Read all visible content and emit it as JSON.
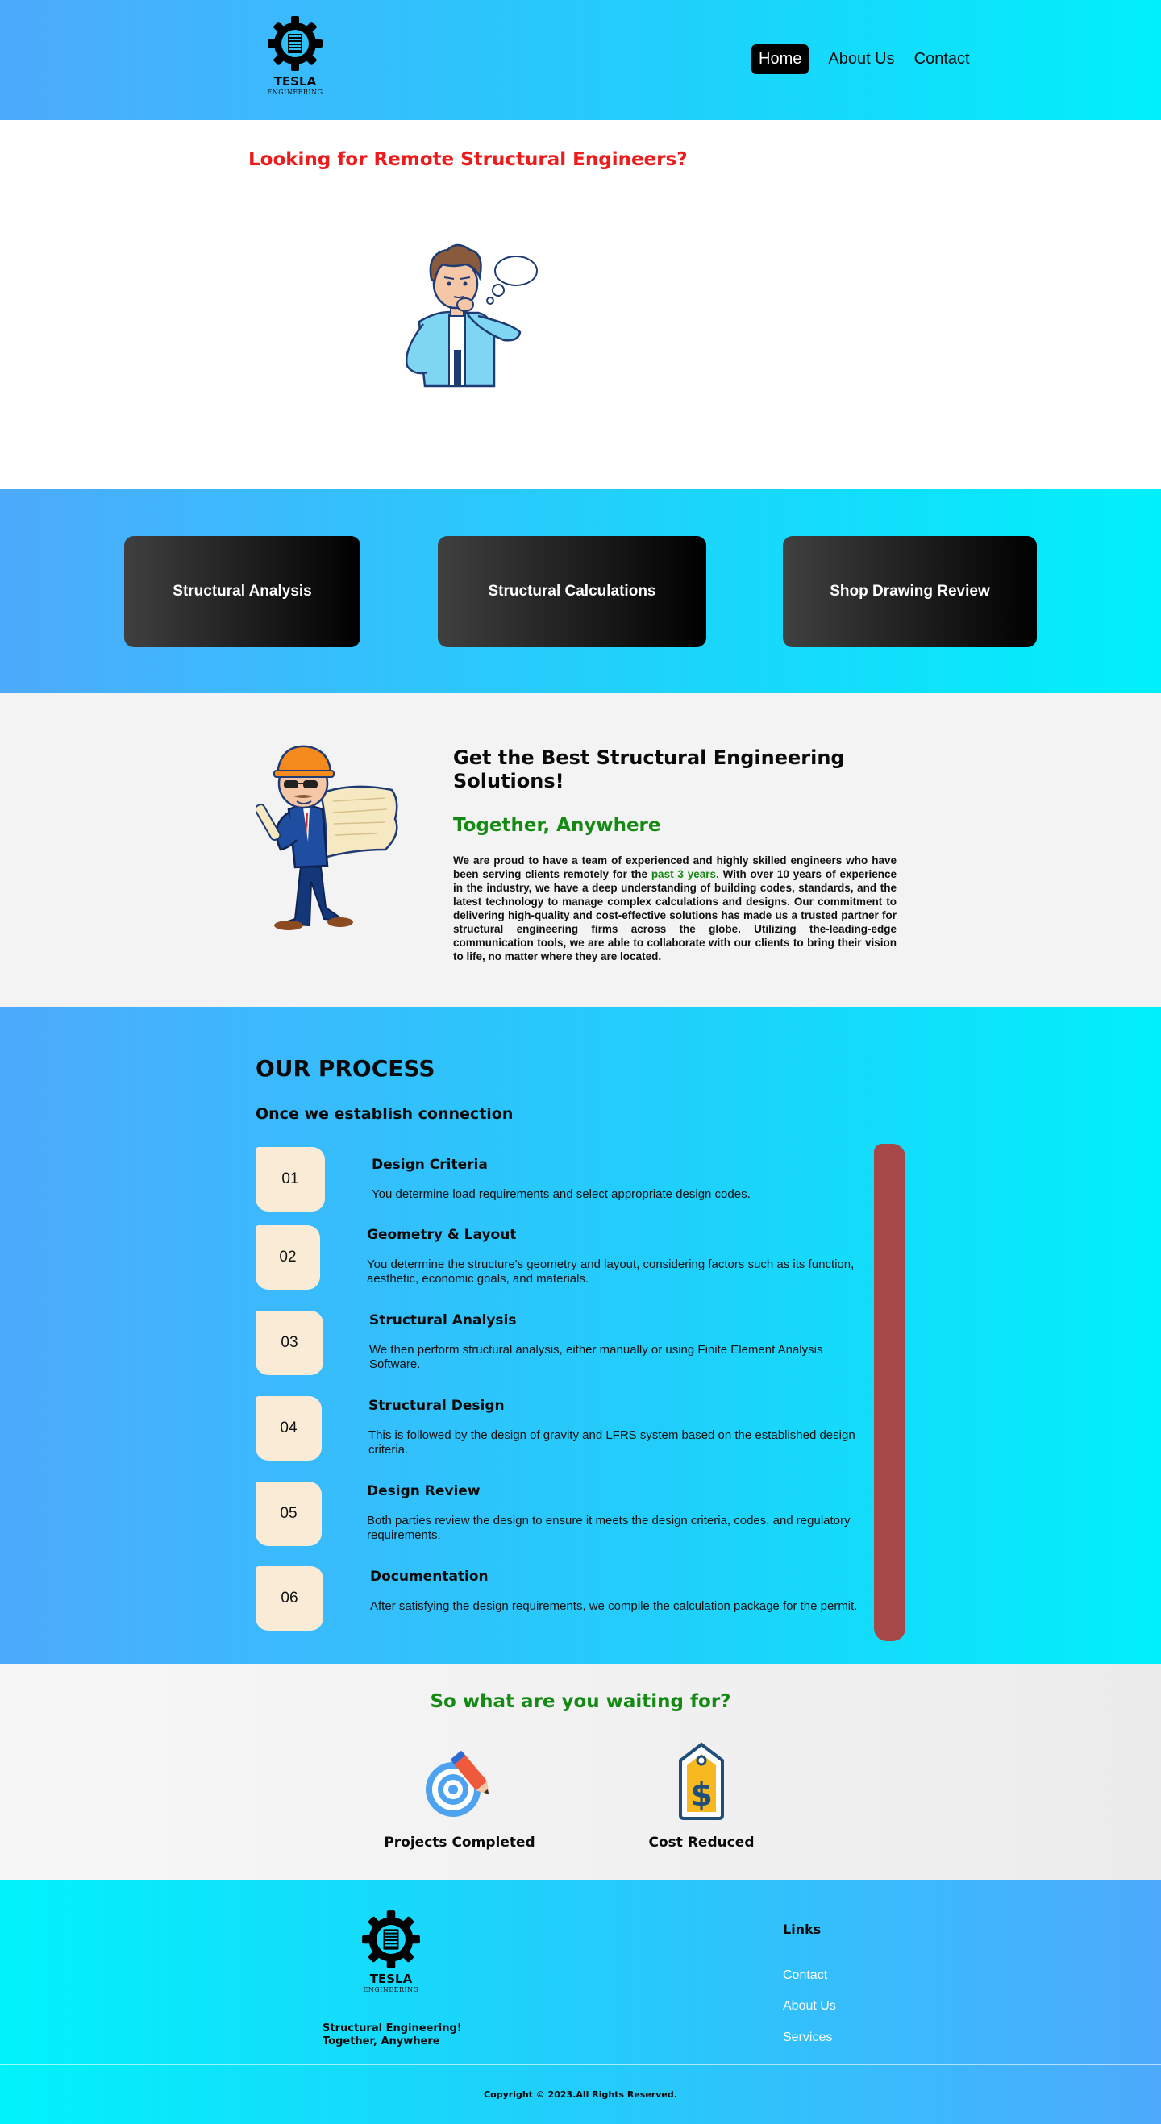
{
  "header": {
    "logo": {
      "brand": "TESLA",
      "sub": "ENGINEERING"
    },
    "nav": [
      {
        "label": "Home",
        "active": true
      },
      {
        "label": "About Us",
        "active": false
      },
      {
        "label": "Contact",
        "active": false
      }
    ]
  },
  "hero": {
    "title": "Looking for Remote Structural Engineers?",
    "illustration": "thinking-man-icon"
  },
  "services": [
    {
      "label": "Structural Analysis"
    },
    {
      "label": "Structural Calculations"
    },
    {
      "label": "Shop Drawing Review"
    }
  ],
  "about": {
    "illustration": "engineer-with-blueprint-icon",
    "heading": "Get the Best Structural Engineering Solutions!",
    "subheading": "Together, Anywhere",
    "paragraph_before": "We are proud to have a team of experienced and highly skilled engineers who have been serving clients remotely for the ",
    "paragraph_highlight": "past 3 years.",
    "paragraph_after": " With over 10 years of experience in the industry, we have a deep understanding of building codes, standards, and the latest technology to manage complex calculations and designs. Our commitment to delivering high-quality and cost-effective solutions has made us a trusted partner for structural engineering firms across the globe. Utilizing the-leading-edge communication tools, we are able to collaborate with our clients to bring their vision to life, no matter where they are located."
  },
  "process": {
    "title": "OUR PROCESS",
    "subtitle": "Once we establish connection",
    "steps": [
      {
        "num": "01",
        "title": "Design Criteria",
        "desc": "You determine load requirements and select appropriate design codes."
      },
      {
        "num": "02",
        "title": "Geometry & Layout",
        "desc": "You determine the structure's geometry and layout, considering factors such as its function, aesthetic, economic goals, and materials."
      },
      {
        "num": "03",
        "title": "Structural Analysis",
        "desc": "We then perform structural analysis, either manually or using Finite Element Analysis Software."
      },
      {
        "num": "04",
        "title": "Structural Design",
        "desc": "This is followed by the design of gravity and LFRS system based on the established design criteria."
      },
      {
        "num": "05",
        "title": "Design Review",
        "desc": "Both parties review the design to ensure it meets the design criteria, codes, and regulatory requirements."
      },
      {
        "num": "06",
        "title": "Documentation",
        "desc": "After satisfying the design requirements, we compile the calculation package for the permit."
      }
    ],
    "accent_color": "#a64848"
  },
  "cta": {
    "title": "So what are you waiting for?",
    "items": [
      {
        "icon": "target-with-pencil-icon",
        "label": "Projects Completed"
      },
      {
        "icon": "price-tag-dollar-icon",
        "label": "Cost Reduced"
      }
    ]
  },
  "footer": {
    "logo": {
      "brand": "TESLA",
      "sub": "ENGINEERING"
    },
    "tagline_1": "Structural Engineering!",
    "tagline_2": "Together, Anywhere",
    "links_title": "Links",
    "links": [
      {
        "label": "Contact"
      },
      {
        "label": "About Us"
      },
      {
        "label": "Services"
      }
    ],
    "copyright": "Copyright © 2023.All Rights Reserved."
  },
  "colors": {
    "gradient_blue": "#4eaafc",
    "gradient_cyan": "#00f0fb",
    "hero_red": "#ec1c1c",
    "accent_green": "#148a14"
  }
}
